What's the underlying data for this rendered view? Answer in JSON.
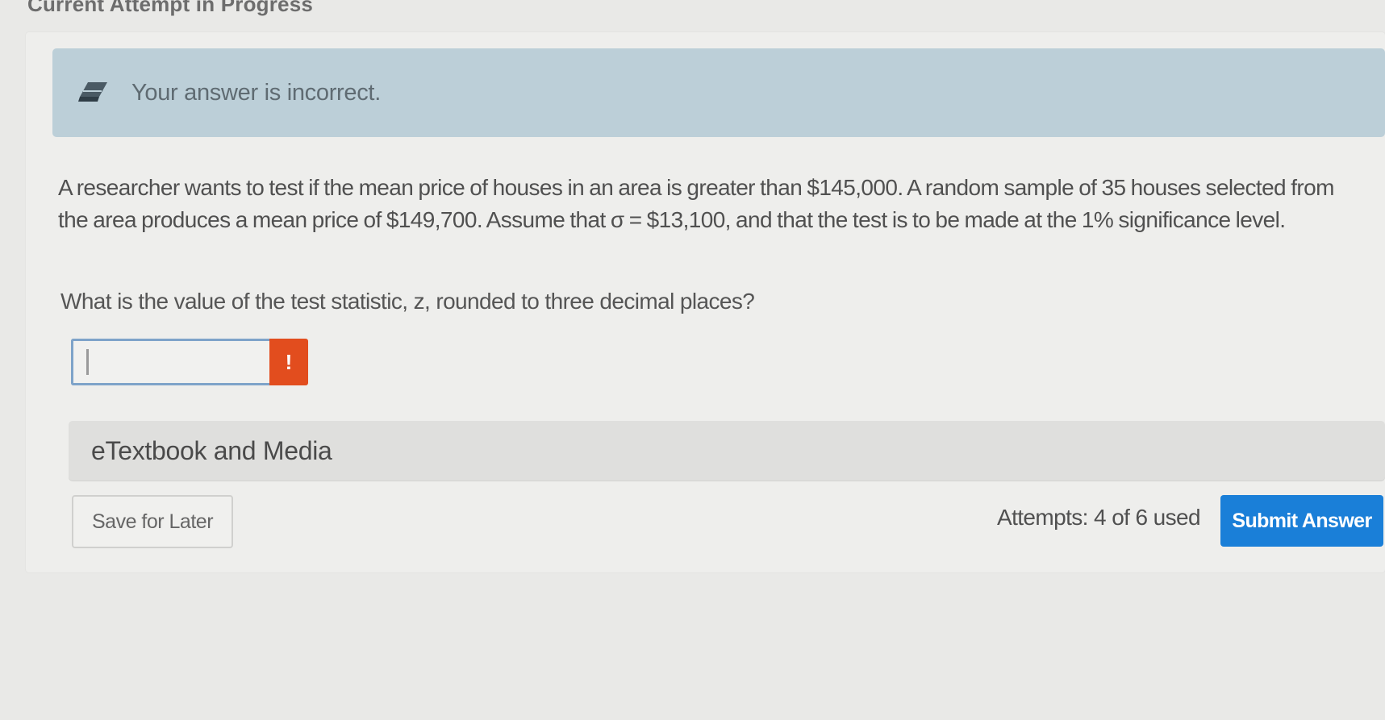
{
  "header": {
    "title": "Current Attempt in Progress"
  },
  "feedback": {
    "icon": "eraser-icon",
    "message": "Your answer is incorrect."
  },
  "question": {
    "text": "A researcher wants to test if the mean price of houses in an area is greater than $145,000. A random sample of 35 houses selected from the area produces a mean price of $149,700. Assume that σ = $13,100, and that the test is to be made at the 1% significance level.",
    "prompt": "What is the value of the test statistic, z, rounded to three decimal places?"
  },
  "answer": {
    "value": "",
    "placeholder": "",
    "error_badge": "!",
    "error_color": "#e24d1e"
  },
  "resources": {
    "label": "eTextbook and Media"
  },
  "footer": {
    "save_label": "Save for Later",
    "attempts": "Attempts: 4 of 6 used",
    "submit_label": "Submit Answer",
    "submit_color": "#1a7fd8"
  }
}
